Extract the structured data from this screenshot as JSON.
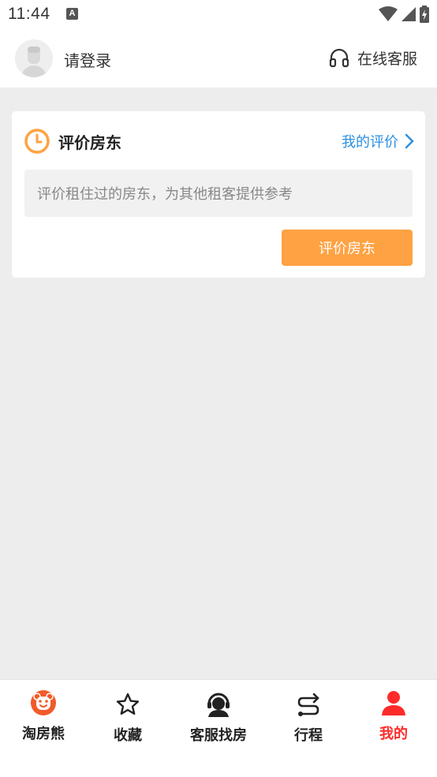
{
  "status_bar": {
    "time": "11:44",
    "notification_badge": "A"
  },
  "header": {
    "login_label": "请登录",
    "service_label": "在线客服"
  },
  "card": {
    "title": "评价房东",
    "my_review_label": "我的评价",
    "input_placeholder": "评价租住过的房东，为其他租客提供参考",
    "submit_label": "评价房东"
  },
  "tabs": [
    {
      "label": "淘房熊",
      "icon": "bear-logo-icon"
    },
    {
      "label": "收藏",
      "icon": "star-icon"
    },
    {
      "label": "客服找房",
      "icon": "customer-service-icon"
    },
    {
      "label": "行程",
      "icon": "route-icon"
    },
    {
      "label": "我的",
      "icon": "person-icon",
      "active": true
    }
  ],
  "colors": {
    "accent_orange": "#fea243",
    "link_blue": "#2a8fe0",
    "active_red": "#ff2a2a",
    "background": "#ededed"
  }
}
